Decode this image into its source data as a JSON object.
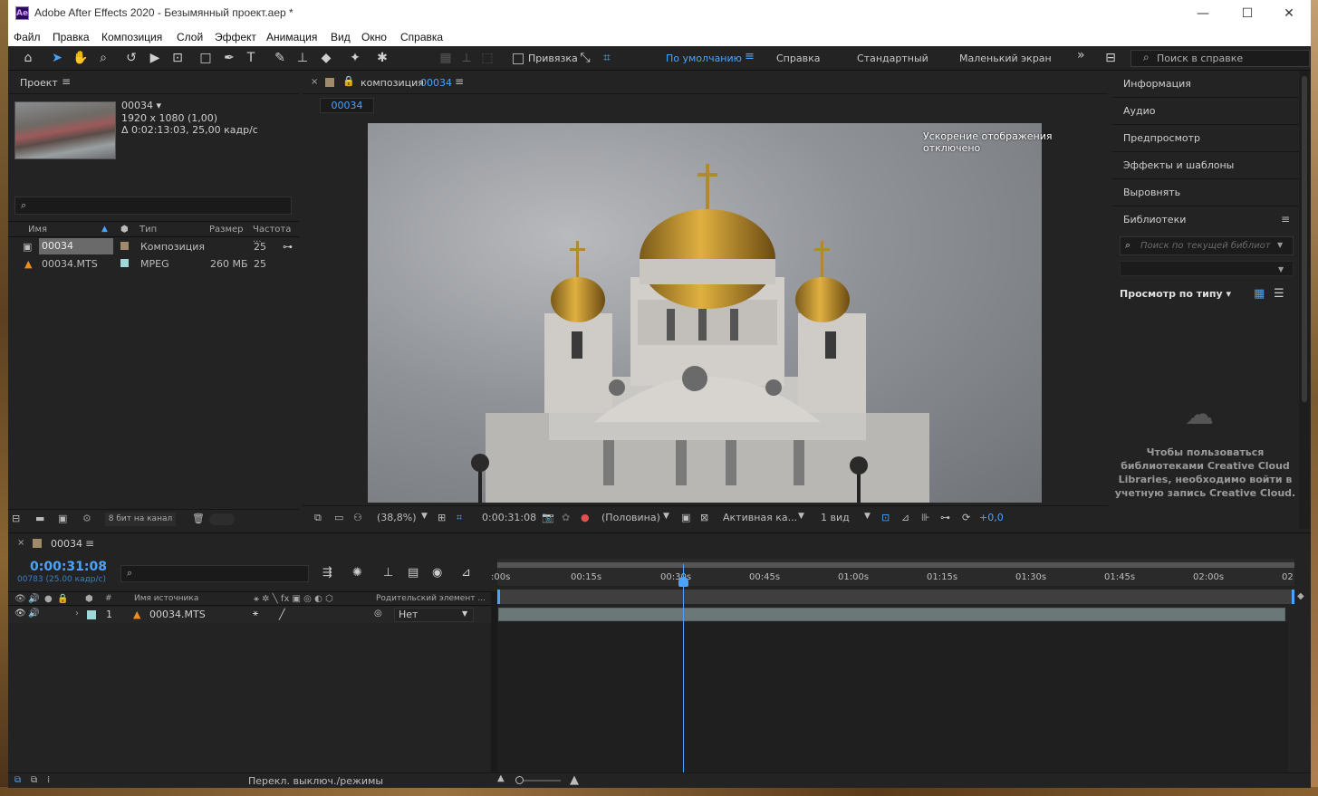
{
  "titlebar": {
    "app_icon": "Ae",
    "title": "Adobe After Effects 2020 - Безымянный проект.aep *",
    "minimize": "—",
    "maximize": "☐",
    "close": "✕"
  },
  "menu": [
    "Файл",
    "Правка",
    "Композиция",
    "Слой",
    "Эффект",
    "Анимация",
    "Вид",
    "Окно",
    "Справка"
  ],
  "toolbar": {
    "snap_label": "Привязка",
    "workspaces": [
      "По умолчанию",
      "Справка",
      "Стандартный",
      "Маленький экран"
    ],
    "active_workspace": "По умолчанию",
    "more": "»",
    "help_search_placeholder": "Поиск в справке"
  },
  "project": {
    "tab_label": "Проект",
    "item_name": "00034 ▾",
    "resolution": "1920 x 1080 (1,00)",
    "duration": "Δ 0:02:13:03, 25,00 кадр/с",
    "columns": [
      "Имя",
      "Тип",
      "Размер",
      "Частота ..."
    ],
    "rows": [
      {
        "name": "00034",
        "type": "Композиция",
        "size": "",
        "rate": "25",
        "label_color": "#a08a6a"
      },
      {
        "name": "00034.MTS",
        "type": "MPEG",
        "size": "260 МБ",
        "rate": "25",
        "label_color": "#9ed8d8"
      }
    ],
    "bit_depth": "8 бит на канал"
  },
  "composition": {
    "tab_prefix": "композиция",
    "tab_name": "00034",
    "subtab": "00034",
    "accel_note": "Ускорение отображения отключено",
    "zoom": "(38,8%)",
    "timecode": "0:00:31:08",
    "resolution": "(Половина)",
    "camera": "Активная ка...",
    "views": "1 вид",
    "exposure": "+0,0"
  },
  "right_panel": {
    "items": [
      "Информация",
      "Аудио",
      "Предпросмотр",
      "Эффекты и шаблоны",
      "Выровнять"
    ],
    "libraries_label": "Библиотеки",
    "lib_search_placeholder": "Поиск по текущей библиот",
    "view_by_type": "Просмотр по типу ▾",
    "message": "Чтобы пользоваться библиотеками Creative Cloud Libraries, необходимо войти в учетную запись Creative Cloud."
  },
  "timeline": {
    "tab_name": "00034",
    "timecode": "0:00:31:08",
    "frame_info": "00783 (25.00 кадр/с)",
    "header_source": "Имя источника",
    "header_hash": "#",
    "header_parent": "Родительский элемент ...",
    "layer": {
      "number": "1",
      "name": "00034.MTS",
      "parent": "Нет"
    },
    "ticks": [
      ":00s",
      "00:15s",
      "00:30s",
      "00:45s",
      "01:00s",
      "01:15s",
      "01:30s",
      "01:45s",
      "02:00s",
      "02"
    ],
    "playhead_seconds": 31.3,
    "footer_label": "Перекл. выключ./режимы"
  }
}
